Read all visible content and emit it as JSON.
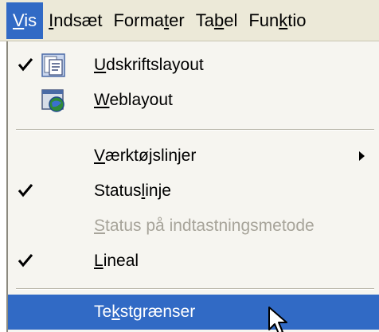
{
  "menubar": {
    "items": [
      {
        "pre": "",
        "mn": "V",
        "post": "is"
      },
      {
        "pre": "",
        "mn": "I",
        "post": "ndsæt"
      },
      {
        "pre": "Forma",
        "mn": "t",
        "post": "er"
      },
      {
        "pre": "Ta",
        "mn": "b",
        "post": "el"
      },
      {
        "pre": "Fun",
        "mn": "k",
        "post": "tio"
      }
    ]
  },
  "menu": {
    "items": [
      {
        "pre": "",
        "mn": "U",
        "post": "dskriftslayout",
        "checked": true,
        "icon": "print-layout-icon",
        "disabled": false,
        "submenu": false
      },
      {
        "pre": "",
        "mn": "W",
        "post": "eblayout",
        "checked": false,
        "icon": "web-layout-icon",
        "disabled": false,
        "submenu": false
      },
      {
        "pre": "",
        "mn": "V",
        "post": "ærktøjslinjer",
        "checked": false,
        "icon": "",
        "disabled": false,
        "submenu": true
      },
      {
        "pre": "Status",
        "mn": "l",
        "post": "inje",
        "checked": true,
        "icon": "",
        "disabled": false,
        "submenu": false
      },
      {
        "pre": "",
        "mn": "S",
        "post": "tatus på indtastningsmetode",
        "checked": false,
        "icon": "",
        "disabled": true,
        "submenu": false
      },
      {
        "pre": "",
        "mn": "L",
        "post": "ineal",
        "checked": true,
        "icon": "",
        "disabled": false,
        "submenu": false
      },
      {
        "pre": "Te",
        "mn": "k",
        "post": "stgrænser",
        "checked": false,
        "icon": "",
        "disabled": false,
        "submenu": false,
        "highlighted": true
      }
    ]
  },
  "colors": {
    "highlight": "#316ac5",
    "menubar_bg": "#ece9d8",
    "menu_bg": "#f6f5f0",
    "disabled_text": "#a7a49a"
  },
  "cursor": "arrow-cursor-icon"
}
